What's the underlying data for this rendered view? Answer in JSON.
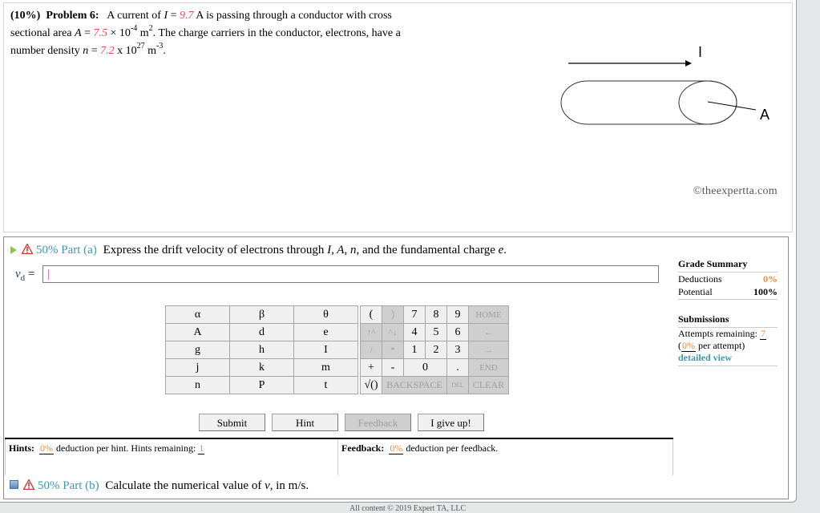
{
  "problem": {
    "weight": "(10%)",
    "label": "Problem 6:",
    "text_1": "A current of ",
    "var_I": "I",
    "eq": " = ",
    "I_value": "9.7",
    "text_2": " A is passing through a conductor with cross",
    "text_3": "sectional area ",
    "var_A": "A",
    "A_value": "7.5",
    "A_times": " × 10",
    "A_exp": "-4",
    "A_unit": " m",
    "A_unit_exp": "2",
    "text_4": ". The charge carriers in the conductor, electrons, have a",
    "text_5": "number density ",
    "var_n": "n",
    "n_value": "7.2",
    "n_times": " x 10",
    "n_exp": "27",
    "n_unit": " m",
    "n_unit_exp": "-3",
    "text_6": "."
  },
  "figure": {
    "current_label": "I",
    "area_label": "A",
    "credit": "©theexpertta.com"
  },
  "part_a": {
    "percent": "50%",
    "label": "Part (a)",
    "prompt_1": "Express the drift velocity of electrons through ",
    "prompt_vars": "I, A, n,",
    "prompt_2": " and the fundamental charge ",
    "prompt_e": "e",
    "prompt_end": ".",
    "var": "v",
    "var_sub": "d",
    "equals": " =",
    "input_value": ""
  },
  "grade_summary": {
    "title": "Grade Summary",
    "deductions_label": "Deductions",
    "deductions_value": "0%",
    "potential_label": "Potential",
    "potential_value": "100%",
    "submissions_title": "Submissions",
    "attempts_label": "Attempts remaining: ",
    "attempts_value": "7",
    "per_attempt_value": "0%",
    "per_attempt_label": " per attempt)",
    "detailed_view": "detailed view"
  },
  "keypad": {
    "symbols": [
      [
        "α",
        "β",
        "θ"
      ],
      [
        "A",
        "d",
        "e"
      ],
      [
        "g",
        "h",
        "I"
      ],
      [
        "j",
        "k",
        "m"
      ],
      [
        "n",
        "P",
        "t"
      ]
    ],
    "keys": {
      "lparen": "(",
      "rparen": ")",
      "k7": "7",
      "k8": "8",
      "k9": "9",
      "home": "HOME",
      "up": "↑^",
      "down": "^↓",
      "k4": "4",
      "k5": "5",
      "k6": "6",
      "left": "←",
      "div": "/",
      "mul": "*",
      "k1": "1",
      "k2": "2",
      "k3": "3",
      "right": "→",
      "plus": "+",
      "minus": "-",
      "k0": "0",
      "dot": ".",
      "end": "END",
      "sqrt": "√()",
      "backspace": "BACKSPACE",
      "del": "DEL",
      "clear": "CLEAR"
    }
  },
  "buttons": {
    "submit": "Submit",
    "hint": "Hint",
    "feedback": "Feedback",
    "give_up": "I give up!"
  },
  "hints": {
    "label": "Hints:",
    "deduction": "0%",
    "text": " deduction per hint. Hints remaining: ",
    "remaining": "1"
  },
  "feedback": {
    "label": "Feedback:",
    "deduction": "0%",
    "text": " deduction per feedback."
  },
  "part_b": {
    "percent": "50%",
    "label": "Part (b)",
    "prompt_1": "Calculate the numerical value of ",
    "prompt_var": "v",
    "prompt_2": ", in m/s."
  },
  "footer": "All content © 2019 Expert TA, LLC"
}
